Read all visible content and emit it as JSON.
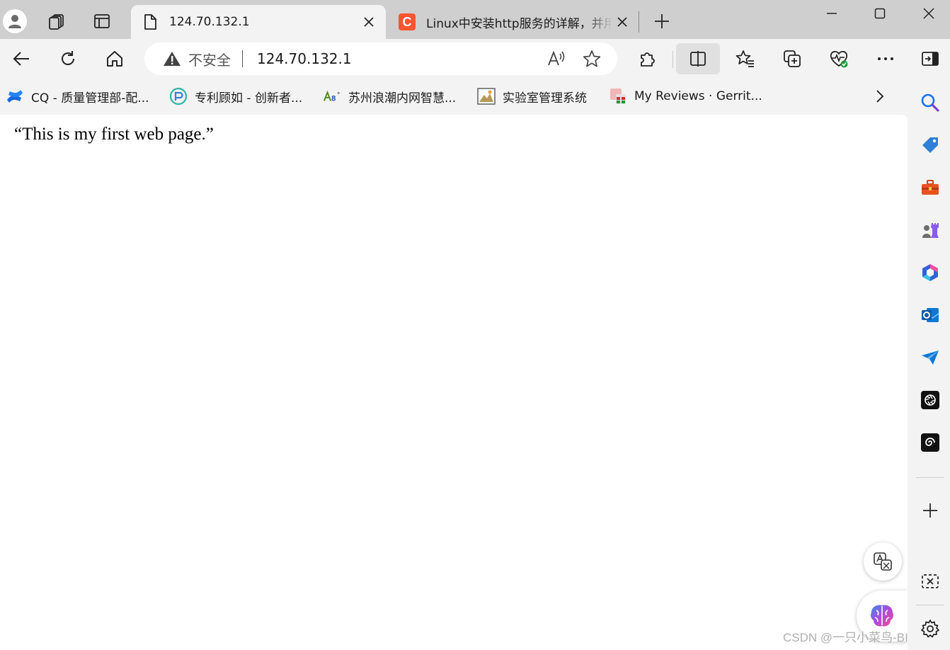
{
  "tabs": [
    {
      "title": "124.70.132.1",
      "active": true,
      "favicon": "page-icon"
    },
    {
      "title": "Linux中安装http服务的详解，并用",
      "active": false,
      "favicon": "csdn-icon",
      "favicon_letter": "C",
      "favicon_color": "#fc5531"
    }
  ],
  "address_bar": {
    "security_label": "不安全",
    "url": "124.70.132.1"
  },
  "bookmarks": [
    {
      "label": "CQ - 质量管理部-配...",
      "icon": "confluence-icon"
    },
    {
      "label": "专利顾如 - 创新者...",
      "icon": "patent-icon"
    },
    {
      "label": "苏州浪潮内网智慧...",
      "icon": "ab-icon"
    },
    {
      "label": "实验室管理系统",
      "icon": "lab-icon"
    },
    {
      "label": "My Reviews · Gerrit...",
      "icon": "gerrit-icon"
    }
  ],
  "page": {
    "text": "“This is my first web page.”"
  },
  "watermark": "CSDN @一只小菜鸟-BIOS",
  "colors": {
    "tabstrip": "#cfcfcf",
    "chrome": "#f3f3f3",
    "content": "#ffffff",
    "accent_blue": "#1a73e8",
    "csdn_red": "#fc5531"
  }
}
